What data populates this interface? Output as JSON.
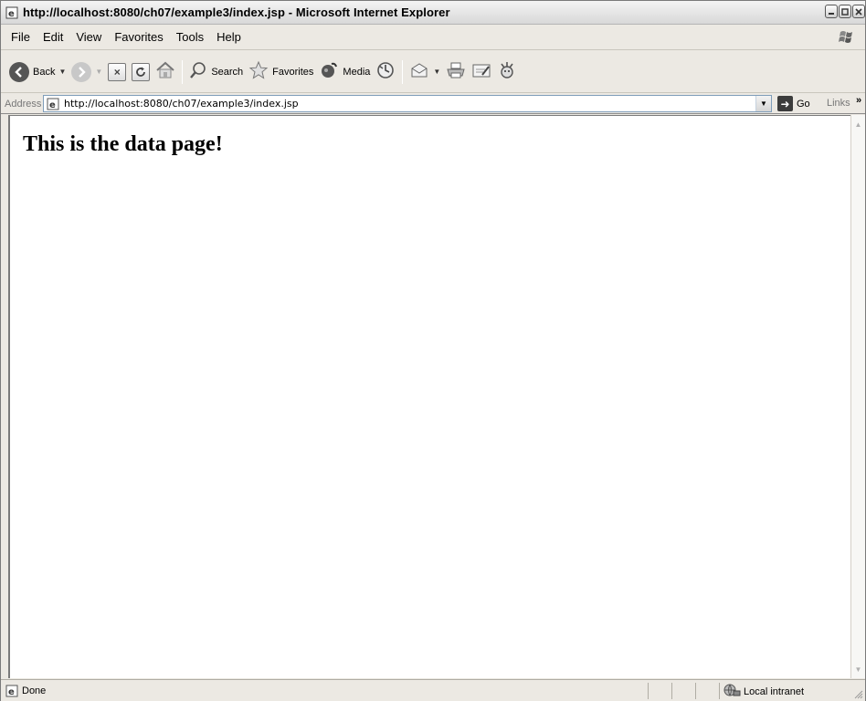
{
  "window": {
    "title": "http://localhost:8080/ch07/example3/index.jsp - Microsoft Internet Explorer"
  },
  "menu": {
    "items": [
      "File",
      "Edit",
      "View",
      "Favorites",
      "Tools",
      "Help"
    ]
  },
  "toolbar": {
    "back_label": "Back",
    "search_label": "Search",
    "favorites_label": "Favorites",
    "media_label": "Media"
  },
  "address": {
    "label": "Address",
    "url": "http://localhost:8080/ch07/example3/index.jsp",
    "go_label": "Go",
    "links_label": "Links"
  },
  "content": {
    "heading": "This is the data page!"
  },
  "status": {
    "text": "Done",
    "zone": "Local intranet"
  }
}
